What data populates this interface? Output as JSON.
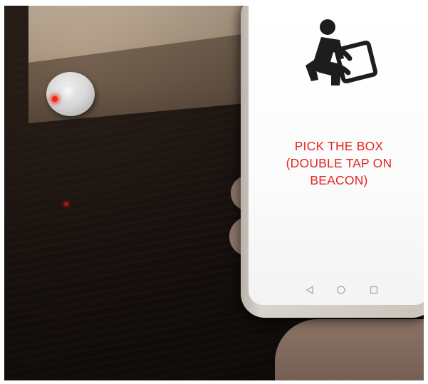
{
  "screen": {
    "instruction_lines": [
      "PICK THE BOX",
      "(DOUBLE TAP ON",
      "BEACON)"
    ],
    "pictogram": "person-lifting-box-icon",
    "text_color": "#e0271f"
  },
  "navigation_bar": {
    "back": "back-triangle-icon",
    "home": "home-circle-icon",
    "recents": "recents-square-icon"
  },
  "scene": {
    "beacon_led_color": "#ff2a1a"
  }
}
